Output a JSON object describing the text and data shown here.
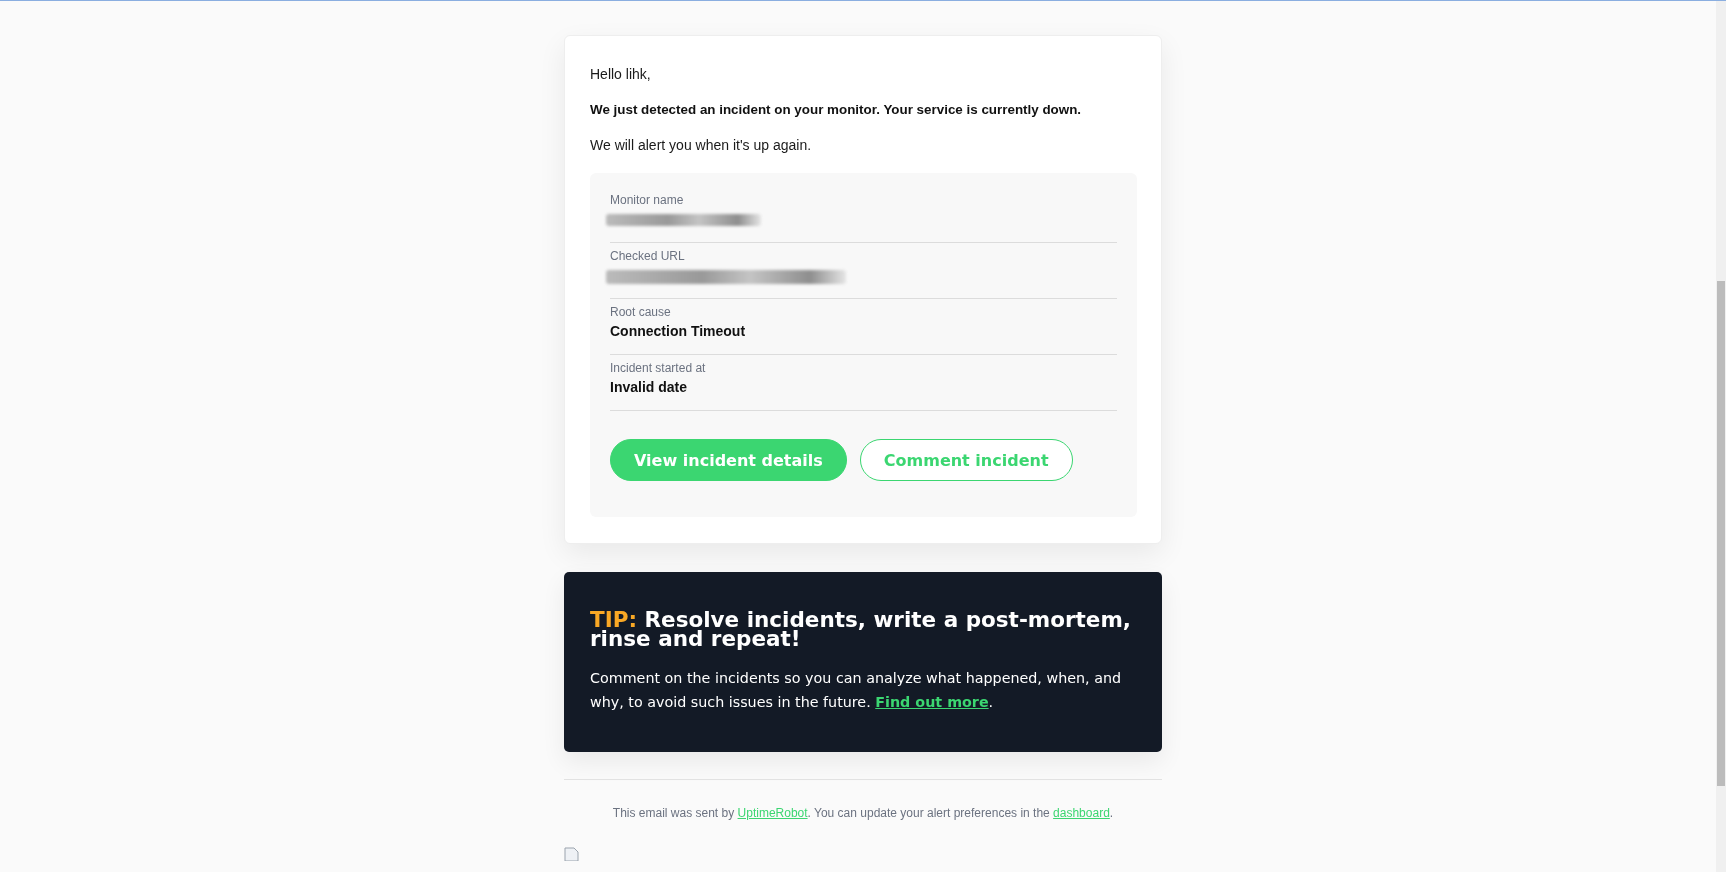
{
  "greeting": "Hello lihk,",
  "alert": "We just detected an incident on your monitor. Your service is currently down.",
  "followup": "We will alert you when it's up again.",
  "details": [
    {
      "label": "Monitor name",
      "kind": "redacted"
    },
    {
      "label": "Checked URL",
      "kind": "redacted"
    },
    {
      "label": "Root cause",
      "kind": "text",
      "value": "Connection Timeout"
    },
    {
      "label": "Incident started at",
      "kind": "text",
      "value": "Invalid date"
    }
  ],
  "buttons": [
    {
      "label": "View incident details",
      "kind": "primary"
    },
    {
      "label": "Comment incident",
      "kind": "outline"
    }
  ],
  "tip": {
    "label": "TIP:",
    "heading": "Resolve incidents, write a post-mortem, rinse and repeat!",
    "body": "Comment on the incidents so you can analyze what happened, when, and why, to avoid such issues in the future.",
    "link": "Find out more",
    "after": "."
  },
  "footer": {
    "before": "This email was sent by",
    "link1": "UptimeRobot",
    "middle": ". You can update your alert preferences in the",
    "link2": "dashboard",
    "after": "."
  }
}
